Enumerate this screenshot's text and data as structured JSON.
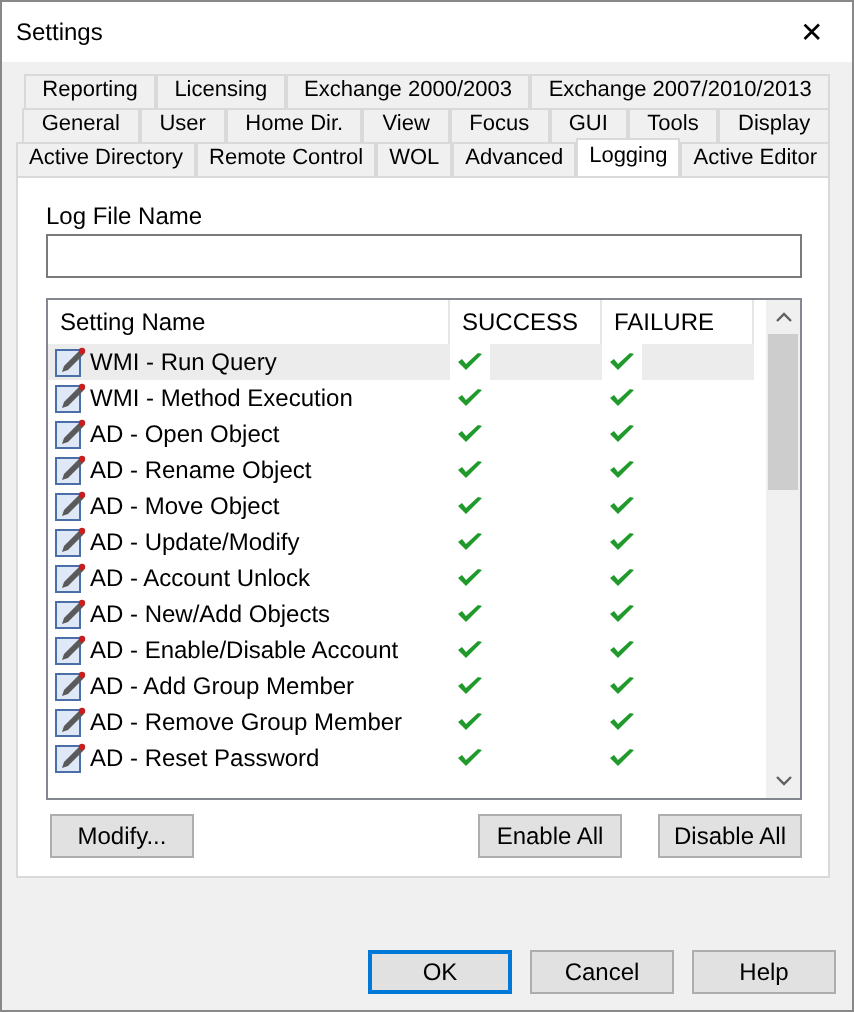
{
  "window": {
    "title": "Settings",
    "close": "✕"
  },
  "tab_rows": [
    [
      {
        "label": "Reporting",
        "selected": false
      },
      {
        "label": "Licensing",
        "selected": false
      },
      {
        "label": "Exchange 2000/2003",
        "selected": false
      },
      {
        "label": "Exchange 2007/2010/2013",
        "selected": false
      }
    ],
    [
      {
        "label": "General",
        "selected": false
      },
      {
        "label": "User",
        "selected": false
      },
      {
        "label": "Home Dir.",
        "selected": false
      },
      {
        "label": "View",
        "selected": false
      },
      {
        "label": "Focus",
        "selected": false
      },
      {
        "label": "GUI",
        "selected": false
      },
      {
        "label": "Tools",
        "selected": false
      },
      {
        "label": "Display",
        "selected": false
      }
    ],
    [
      {
        "label": "Active Directory",
        "selected": false
      },
      {
        "label": "Remote Control",
        "selected": false
      },
      {
        "label": "WOL",
        "selected": false
      },
      {
        "label": "Advanced",
        "selected": false
      },
      {
        "label": "Logging",
        "selected": true
      },
      {
        "label": "Active Editor",
        "selected": false
      }
    ]
  ],
  "log_file": {
    "label": "Log File Name"
  },
  "table": {
    "columns": [
      "Setting Name",
      "SUCCESS",
      "FAILURE"
    ],
    "rows": [
      {
        "name": "WMI - Run Query",
        "success": true,
        "failure": true,
        "selected": true
      },
      {
        "name": "WMI - Method Execution",
        "success": true,
        "failure": true,
        "selected": false
      },
      {
        "name": "AD - Open Object",
        "success": true,
        "failure": true,
        "selected": false
      },
      {
        "name": "AD - Rename Object",
        "success": true,
        "failure": true,
        "selected": false
      },
      {
        "name": "AD - Move Object",
        "success": true,
        "failure": true,
        "selected": false
      },
      {
        "name": "AD - Update/Modify",
        "success": true,
        "failure": true,
        "selected": false
      },
      {
        "name": "AD - Account Unlock",
        "success": true,
        "failure": true,
        "selected": false
      },
      {
        "name": "AD - New/Add Objects",
        "success": true,
        "failure": true,
        "selected": false
      },
      {
        "name": "AD - Enable/Disable Account",
        "success": true,
        "failure": true,
        "selected": false
      },
      {
        "name": "AD - Add Group Member",
        "success": true,
        "failure": true,
        "selected": false
      },
      {
        "name": "AD - Remove Group Member",
        "success": true,
        "failure": true,
        "selected": false
      },
      {
        "name": "AD - Reset Password",
        "success": true,
        "failure": true,
        "selected": false
      }
    ]
  },
  "panel_buttons": [
    "Modify...",
    "Enable All",
    "Disable All"
  ],
  "dialog_buttons": [
    {
      "label": "OK",
      "focused": true
    },
    {
      "label": "Cancel",
      "focused": false
    },
    {
      "label": "Help",
      "focused": false
    }
  ]
}
